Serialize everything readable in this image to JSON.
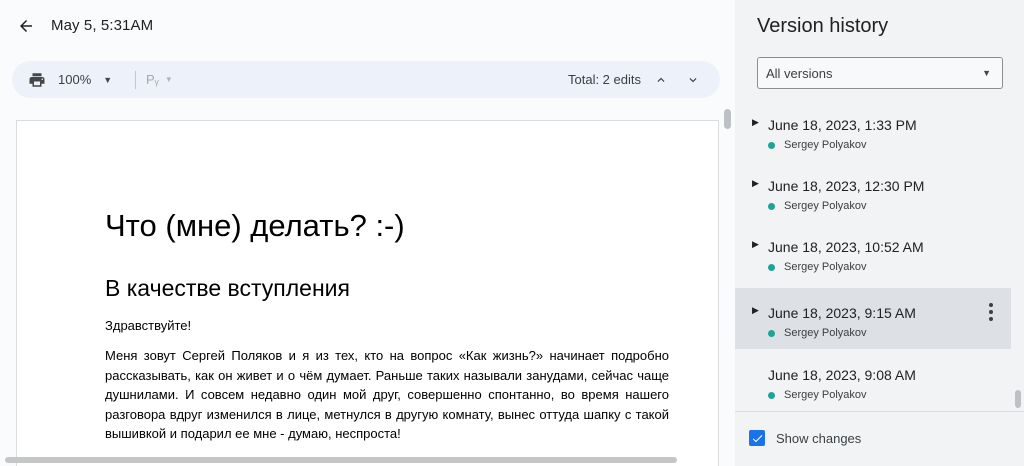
{
  "header": {
    "title": "May 5, 5:31AM"
  },
  "toolbar": {
    "zoom": "100%",
    "styles_glyph": "Pᵧ",
    "total_edits": "Total: 2 edits"
  },
  "document": {
    "heading1": "Что (мне) делать? :-)",
    "heading2": "В качестве вступления",
    "greeting": "Здравствуйте!",
    "paragraph": "Меня зовут Сергей Поляков и я из тех, кто на вопрос «Как жизнь?» начинает подробно рассказывать, как он живет и о чём думает. Раньше таких называли занудами, сейчас чаще душнилами. И совсем недавно один мой друг, совершенно спонтанно, во время нашего разговора вдруг изменился в лице, метнулся в другую комнату, вынес оттуда шапку с такой вышивкой и подарил ее мне - думаю, неспроста!"
  },
  "panel": {
    "title": "Version history",
    "filter_value": "All versions",
    "versions": [
      {
        "date": "June 18, 2023, 1:33 PM",
        "author": "Sergey Polyakov",
        "expandable": true,
        "selected": false
      },
      {
        "date": "June 18, 2023, 12:30 PM",
        "author": "Sergey Polyakov",
        "expandable": true,
        "selected": false
      },
      {
        "date": "June 18, 2023, 10:52 AM",
        "author": "Sergey Polyakov",
        "expandable": true,
        "selected": false
      },
      {
        "date": "June 18, 2023, 9:15 AM",
        "author": "Sergey Polyakov",
        "expandable": true,
        "selected": true
      },
      {
        "date": "June 18, 2023, 9:08 AM",
        "author": "Sergey Polyakov",
        "expandable": false,
        "selected": false
      }
    ],
    "show_changes_label": "Show changes",
    "show_changes_checked": true
  },
  "colors": {
    "accent": "#1a73e8",
    "author_dot": "#1ea496",
    "selected_row": "#dde1e5"
  }
}
